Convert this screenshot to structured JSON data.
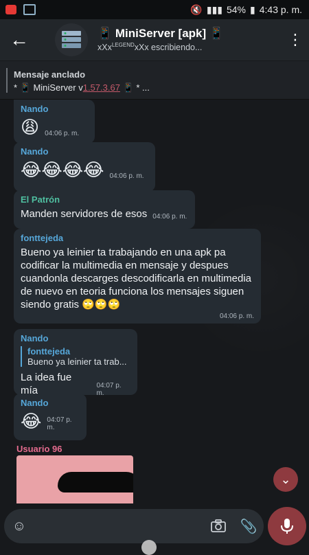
{
  "status_bar": {
    "battery": "54%",
    "time": "4:43 p. m."
  },
  "header": {
    "title": "📱 MiniServer [apk] 📱",
    "subtitle_prefix": "xXx",
    "subtitle_sup": "LEGEND",
    "subtitle_suffix": "xXx escribiendo...",
    "back_icon": "arrow-left-icon",
    "menu_icon": "kebab-icon"
  },
  "pinned": {
    "label": "Mensaje anclado",
    "text_prefix": "* 📱 MiniServer v",
    "version": "1.57.3.67",
    "text_suffix": " 📱 * ..."
  },
  "messages": [
    {
      "sender": "Nando",
      "sender_color": "#56a7d9",
      "emoji": "😩",
      "time": "04:06 p. m."
    },
    {
      "sender": "Nando",
      "sender_color": "#56a7d9",
      "emoji": "😂😂😂😂",
      "time": "04:06 p. m."
    },
    {
      "sender": "El Patrón",
      "sender_color": "#4fbfa0",
      "text": "Manden servidores de esos",
      "time": "04:06 p. m."
    },
    {
      "sender": "fonttejeda",
      "sender_color": "#56a7d9",
      "text": "Bueno ya leinier ta trabajando en una apk pa codificar la multimedia en mensaje y despues cuandonla descarges descodificarla en multimedia de nuevo en teoria funciona los mensajes siguen siendo gratis 🙄🙄🙄",
      "time": "04:06 p. m."
    },
    {
      "sender": "Nando",
      "sender_color": "#56a7d9",
      "reply_name": "fonttejeda",
      "reply_text": "Bueno ya leinier ta trab...",
      "text": "La idea fue mía",
      "time": "04:07 p. m."
    },
    {
      "sender": "Nando",
      "sender_color": "#56a7d9",
      "emoji": "😂",
      "time": "04:07 p. m."
    }
  ],
  "photo_message": {
    "sender": "Usuario 96",
    "sender_color": "#e66c8f"
  },
  "input": {
    "placeholder": ""
  },
  "colors": {
    "accent": "#8e3a3f",
    "bubble": "#252c33",
    "header": "#22262a"
  }
}
